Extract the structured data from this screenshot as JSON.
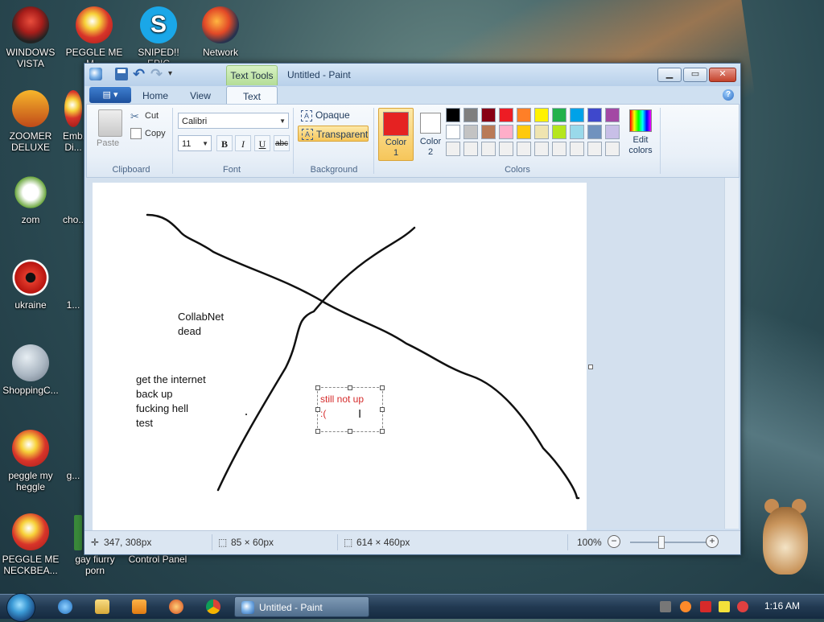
{
  "desktop": {
    "icons": [
      {
        "label": "WINDOWS\nVISTA",
        "icon": "vista-logo-icon"
      },
      {
        "label": "PEGGLE ME\nM...",
        "icon": "peggle-icon"
      },
      {
        "label": "SNIPED!! EPIC",
        "icon": "skype-icon"
      },
      {
        "label": "Network",
        "icon": "network-globe-icon"
      },
      {
        "label": "ZOOMER\nDELUXE",
        "icon": "zoomer-icon"
      },
      {
        "label": "Emb...\nDi...",
        "icon": "game-icon"
      },
      {
        "label": "zom",
        "icon": "flower-icon"
      },
      {
        "label": "cho...",
        "icon": "file-icon"
      },
      {
        "label": "ukraine",
        "icon": "radiation-icon"
      },
      {
        "label": "1...",
        "icon": "file-icon"
      },
      {
        "label": "ShoppingC...",
        "icon": "flash-icon"
      },
      {
        "label": "peggle my\nheggle",
        "icon": "peggle-icon"
      },
      {
        "label": "g...",
        "icon": "file-icon"
      },
      {
        "label": "PEGGLE ME\nNECKBEA...",
        "icon": "peggle-icon"
      },
      {
        "label": "gay fiurry\nporn",
        "icon": "file-icon"
      },
      {
        "label": "Control Panel",
        "icon": "control-panel-icon"
      }
    ]
  },
  "window": {
    "title": "Untitled - Paint",
    "context_tab": "Text Tools",
    "controls": {
      "minimize": "▁",
      "maximize": "▭",
      "close": "✕"
    }
  },
  "ribbon": {
    "app_menu": "▤ ▾",
    "tabs": [
      "Home",
      "View",
      "Text"
    ],
    "active_tab": "Text",
    "clipboard": {
      "label": "Clipboard",
      "paste": "Paste",
      "cut": "Cut",
      "copy": "Copy"
    },
    "font": {
      "label": "Font",
      "family": "Calibri",
      "size": "11",
      "bold": "B",
      "italic": "I",
      "underline": "U",
      "strikethrough": "abc"
    },
    "background": {
      "label": "Background",
      "opaque": "Opaque",
      "transparent": "Transparent",
      "selected": "Transparent"
    },
    "colors": {
      "label": "Colors",
      "color1_label": "Color\n1",
      "color2_label": "Color\n2",
      "color1": "#e52222",
      "color2": "#ffffff",
      "edit_label": "Edit\ncolors",
      "palette_row1": [
        "#000000",
        "#7f7f7f",
        "#880015",
        "#ed1c24",
        "#ff7f27",
        "#fff200",
        "#22b14c",
        "#00a2e8",
        "#3f48cc",
        "#a349a4"
      ],
      "palette_row2": [
        "#ffffff",
        "#c3c3c3",
        "#b97a57",
        "#ffaec9",
        "#ffc90e",
        "#efe4b0",
        "#b5e61d",
        "#99d9ea",
        "#7092be",
        "#c8bfe7"
      ],
      "palette_row3": [
        "#f0f0f0",
        "#f0f0f0",
        "#f0f0f0",
        "#f0f0f0",
        "#f0f0f0",
        "#f0f0f0",
        "#f0f0f0",
        "#f0f0f0",
        "#f0f0f0",
        "#f0f0f0"
      ]
    }
  },
  "canvas": {
    "text_blocks": [
      {
        "text": "CollabNet\ndead"
      },
      {
        "text": "get the internet\nback up\nfucking hell\ntest"
      }
    ],
    "active_textbox": {
      "text": "still not up\n:(",
      "color": "#d52b2b"
    }
  },
  "statusbar": {
    "cursor_pos": "347, 308px",
    "selection_size": "85 × 60px",
    "canvas_size": "614 × 460px",
    "zoom": "100%",
    "zoom_minus": "−",
    "zoom_plus": "+"
  },
  "taskbar": {
    "pinned": [
      "internet-explorer-icon",
      "folder-icon",
      "media-player-icon",
      "game-icon",
      "chrome-icon"
    ],
    "task_label": "Untitled - Paint",
    "clock": "1:16 AM"
  }
}
